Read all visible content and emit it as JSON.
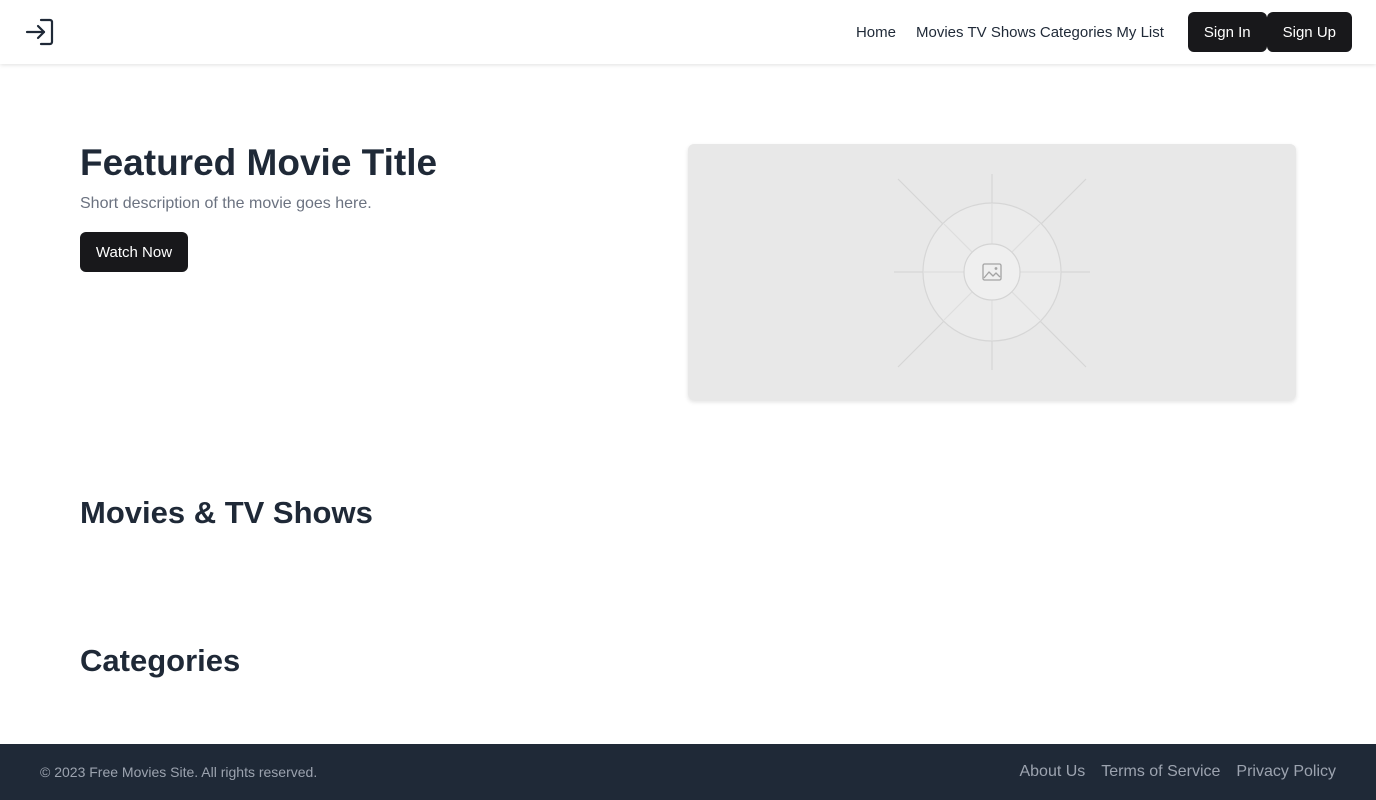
{
  "header": {
    "logo_icon": "login-arrow-icon",
    "nav": {
      "home": "Home",
      "movies": "Movies",
      "tv_shows": "TV Shows",
      "categories": "Categories",
      "my_list": "My List"
    },
    "sign_in": "Sign In",
    "sign_up": "Sign Up"
  },
  "hero": {
    "title": "Featured Movie Title",
    "description": "Short description of the movie goes here.",
    "cta": "Watch Now",
    "image_icon": "image-placeholder-icon"
  },
  "sections": {
    "movies_title": "Movies & TV Shows",
    "categories_title": "Categories"
  },
  "footer": {
    "copyright": "© 2023 Free Movies Site. All rights reserved.",
    "links": [
      "About Us",
      "Terms of Service",
      "Privacy Policy"
    ]
  },
  "colors": {
    "primary_button": "#18181b",
    "footer_bg": "#1f2937",
    "text_dark": "#1f2937",
    "text_muted": "#6b7280",
    "placeholder_bg": "#e8e8e8"
  }
}
